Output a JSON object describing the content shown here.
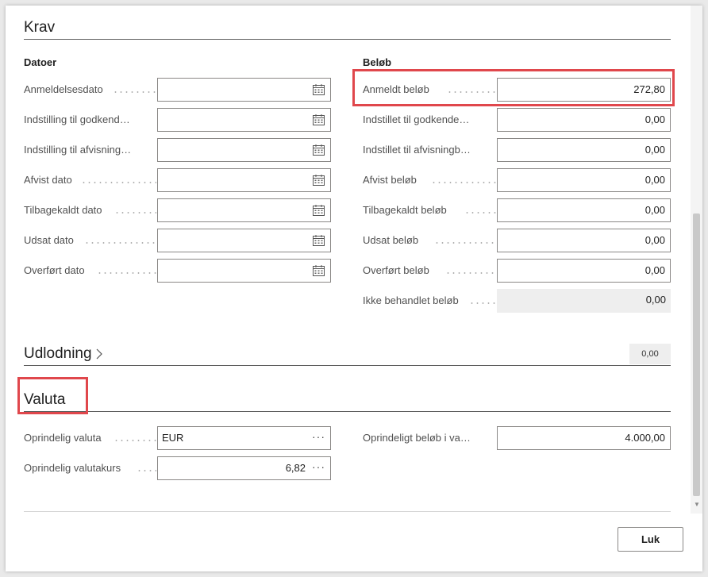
{
  "sections": {
    "krav": "Krav",
    "udlodning": "Udlodning",
    "valuta": "Valuta"
  },
  "groups": {
    "datoer": "Datoer",
    "beloeb": "Beløb"
  },
  "dates": [
    {
      "label": "Anmeldelsesdato",
      "value": ""
    },
    {
      "label": "Indstilling til godkend…",
      "value": ""
    },
    {
      "label": "Indstilling til afvisning…",
      "value": ""
    },
    {
      "label": "Afvist dato",
      "value": ""
    },
    {
      "label": "Tilbagekaldt dato",
      "value": ""
    },
    {
      "label": "Udsat dato",
      "value": ""
    },
    {
      "label": "Overført dato",
      "value": ""
    }
  ],
  "amounts": [
    {
      "label": "Anmeldt beløb",
      "value": "272,80"
    },
    {
      "label": "Indstillet til godkende…",
      "value": "0,00"
    },
    {
      "label": "Indstillet til afvisningb…",
      "value": "0,00"
    },
    {
      "label": "Afvist beløb",
      "value": "0,00"
    },
    {
      "label": "Tilbagekaldt beløb",
      "value": "0,00"
    },
    {
      "label": "Udsat beløb",
      "value": "0,00"
    },
    {
      "label": "Overført beløb",
      "value": "0,00"
    },
    {
      "label": "Ikke behandlet beløb",
      "value": "0,00"
    }
  ],
  "udlodning_total": "0,00",
  "currency": {
    "original_label": "Oprindelig valuta",
    "original_value": "EUR",
    "rate_label": "Oprindelig valutakurs",
    "rate_value": "6,82",
    "amount_label": "Oprindeligt beløb i va…",
    "amount_value": "4.000,00"
  },
  "footer": {
    "close_label": "Luk"
  },
  "colors": {
    "highlight": "#e0474c"
  }
}
